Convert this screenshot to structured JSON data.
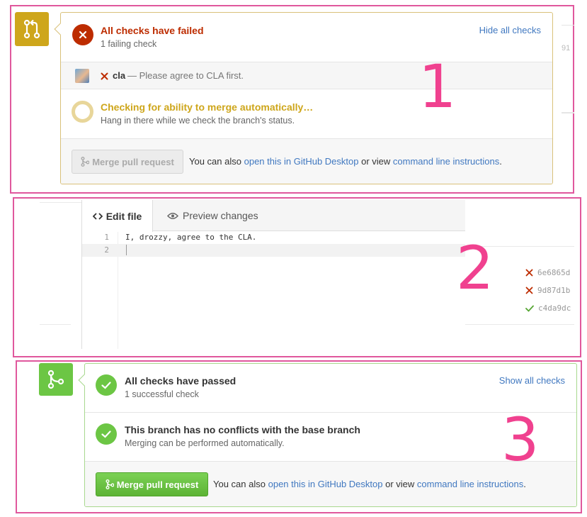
{
  "colors": {
    "annotation_pink": "#e0589d",
    "number_pink": "#f0418f",
    "failed_red": "#bd2c00",
    "pending_yellow": "#cea61b",
    "success_green": "#6cc644",
    "link_blue": "#4078c0"
  },
  "panel1": {
    "annotation_number": "1",
    "status_icon": "git-pull-request-icon",
    "checks_title": "All checks have failed",
    "checks_subtitle": "1 failing check",
    "toggle_link": "Hide all checks",
    "check": {
      "name": "cla",
      "description": "— Please agree to CLA first.",
      "status_icon": "x-icon"
    },
    "merge_title": "Checking for ability to merge automatically…",
    "merge_subtitle": "Hang in there while we check the branch's status.",
    "merge_button": "Merge pull request",
    "footer_prefix": "You can also",
    "footer_desktop_link": "open this in GitHub Desktop",
    "footer_middle": "or view",
    "footer_cli_link": "command line instructions",
    "footer_suffix": ".",
    "side_fragment": "91"
  },
  "panel2": {
    "annotation_number": "2",
    "tabs": [
      {
        "label": "Edit file",
        "icon": "code-icon",
        "active": true
      },
      {
        "label": "Preview changes",
        "icon": "eye-icon",
        "active": false
      }
    ],
    "editor_lines": [
      {
        "number": "1",
        "text": "I, drozzy, agree to the CLA."
      },
      {
        "number": "2",
        "text": ""
      }
    ],
    "commits": [
      {
        "sha": "6e6865d",
        "status": "failed"
      },
      {
        "sha": "9d87d1b",
        "status": "failed"
      },
      {
        "sha": "c4da9dc",
        "status": "passed"
      }
    ]
  },
  "panel3": {
    "annotation_number": "3",
    "status_icon": "git-merge-icon",
    "checks_title": "All checks have passed",
    "checks_subtitle": "1 successful check",
    "toggle_link": "Show all checks",
    "conflicts_title": "This branch has no conflicts with the base branch",
    "conflicts_subtitle": "Merging can be performed automatically.",
    "merge_button": "Merge pull request",
    "footer_prefix": "You can also",
    "footer_desktop_link": "open this in GitHub Desktop",
    "footer_middle": "or view",
    "footer_cli_link": "command line instructions",
    "footer_suffix": "."
  }
}
